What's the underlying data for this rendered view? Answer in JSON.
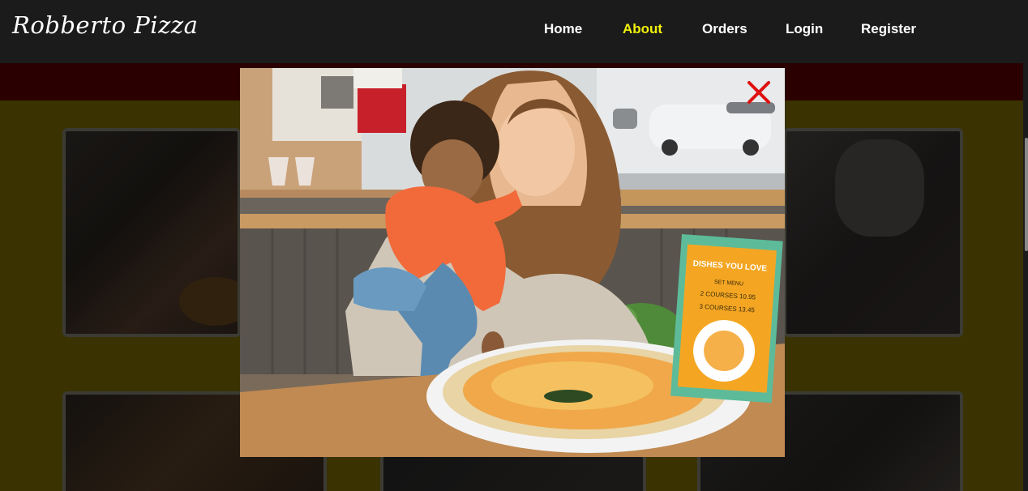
{
  "brand": "Robberto Pizza",
  "nav": [
    {
      "label": "Home"
    },
    {
      "label": "About"
    },
    {
      "label": "Orders"
    },
    {
      "label": "Login"
    },
    {
      "label": "Register"
    }
  ],
  "menu_card": {
    "title": "DISHES YOU LOVE",
    "subtitle": "SET MENU",
    "line1": "2 COURSES 10.95",
    "line2": "3 COURSES 13.45"
  },
  "colors": {
    "navbar": "#1b1b1b",
    "nav_active": "#f0f00a",
    "close": "#e01010"
  }
}
